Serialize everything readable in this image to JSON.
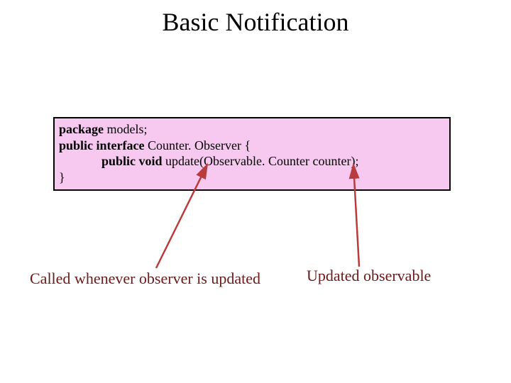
{
  "title": "Basic Notification",
  "code": {
    "kw_package": "package",
    "models_semi": " models;",
    "kw_public_interface": "public interface",
    "iface_name": " Counter. Observer {",
    "kw_public_void": "public void",
    "method_sig": " update(Observable. Counter counter);",
    "close_brace": "}"
  },
  "annotations": {
    "left": "Called whenever observer is updated",
    "right": "Updated observable"
  },
  "colors": {
    "box_fill": "#f7c8f0",
    "arrow": "#b83c3c",
    "annot_text": "#6a1a1a"
  }
}
